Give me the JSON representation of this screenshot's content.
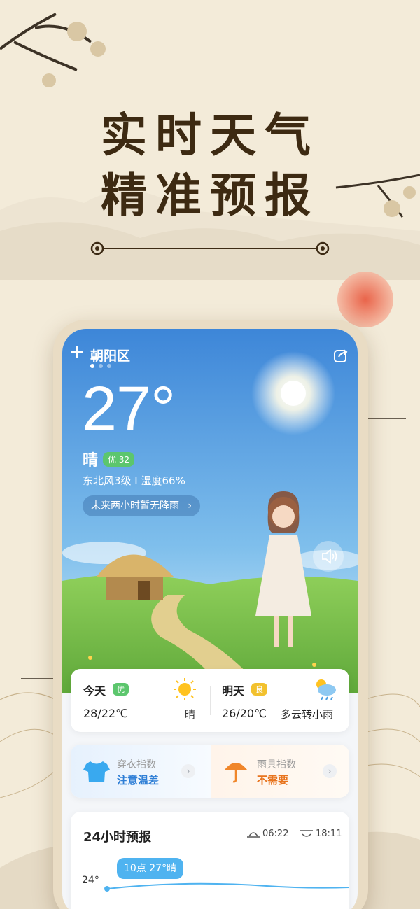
{
  "promo": {
    "headline_line1": "实时天气",
    "headline_line2": "精准预报"
  },
  "app": {
    "location": "朝阳区",
    "add_icon": "plus-icon",
    "share_icon": "share-icon",
    "current": {
      "temperature": "27°",
      "condition": "晴",
      "aqi_label": "优 32",
      "wind_humidity": "东北风3级 I 湿度66%",
      "rain_forecast": "未来两小时暂无降雨",
      "rain_chevron": "›"
    },
    "forecast": {
      "today": {
        "label": "今天",
        "aqi": "优",
        "temp": "28/22℃",
        "condition": "晴",
        "icon": "sun-icon"
      },
      "tomorrow": {
        "label": "明天",
        "aqi": "良",
        "temp": "26/20℃",
        "condition": "多云转小雨",
        "icon": "cloud-rain-icon"
      }
    },
    "indices": {
      "clothing": {
        "title": "穿衣指数",
        "value": "注意温差",
        "icon": "shirt-icon"
      },
      "umbrella": {
        "title": "雨具指数",
        "value": "不需要",
        "icon": "umbrella-icon"
      },
      "arrow": "›"
    },
    "hourly": {
      "title": "24小时预报",
      "sunrise": "06:22",
      "sunset": "18:11",
      "y_label": "24°",
      "tooltip": "10点  27°晴"
    }
  },
  "colors": {
    "background": "#f3ebd9",
    "headline": "#3d2a12",
    "sky_top": "#3d86d8",
    "aqi_good": "#5cc66d",
    "aqi_fair": "#f2c12e",
    "clothing_value": "#2f7fd6",
    "umbrella_value": "#e8741e",
    "tooltip": "#4fb3f0"
  }
}
